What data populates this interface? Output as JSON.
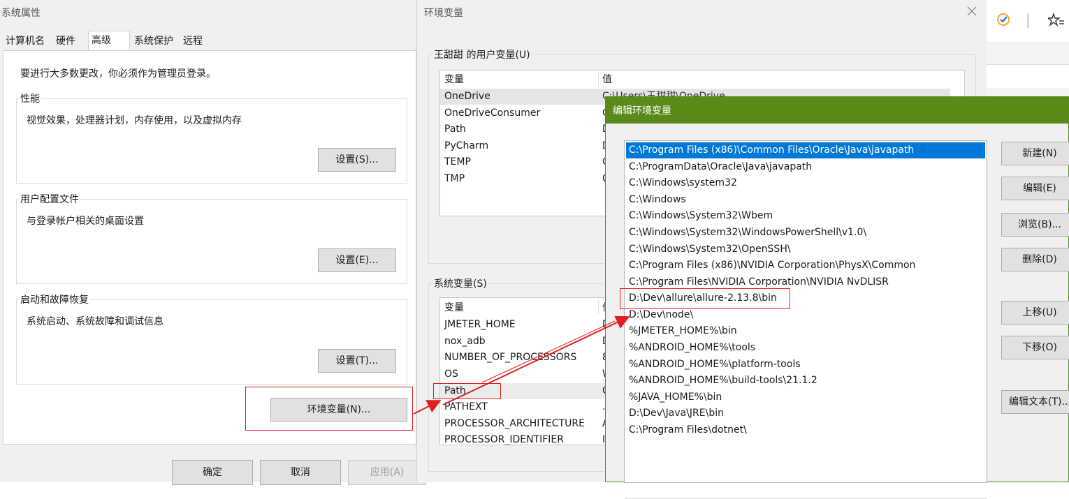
{
  "sys_props": {
    "title": "系统属性",
    "tabs": [
      "计算机名",
      "硬件",
      "高级",
      "系统保护",
      "远程"
    ],
    "admin_note": "要进行大多数更改，你必须作为管理员登录。",
    "performance": {
      "title": "性能",
      "desc": "视觉效果，处理器计划，内存使用，以及虚拟内存",
      "button": "设置(S)..."
    },
    "profiles": {
      "title": "用户配置文件",
      "desc": "与登录帐户相关的桌面设置",
      "button": "设置(E)..."
    },
    "startup": {
      "title": "启动和故障恢复",
      "desc": "系统启动、系统故障和调试信息",
      "button": "设置(T)..."
    },
    "env_button": "环境变量(N)...",
    "ok": "确定",
    "cancel": "取消",
    "apply": "应用(A)"
  },
  "env_vars": {
    "title": "环境变量",
    "user_group": "王甜甜 的用户变量(U)",
    "col_var": "变量",
    "col_val": "值",
    "user_rows": [
      {
        "name": "OneDrive",
        "value": "C:\\Users\\王甜甜\\OneDrive"
      },
      {
        "name": "OneDriveConsumer",
        "value": "C"
      },
      {
        "name": "Path",
        "value": "D"
      },
      {
        "name": "PyCharm",
        "value": "D"
      },
      {
        "name": "TEMP",
        "value": "C"
      },
      {
        "name": "TMP",
        "value": "C"
      }
    ],
    "sys_group": "系统变量(S)",
    "sys_rows": [
      {
        "name": "JMETER_HOME",
        "value": "D"
      },
      {
        "name": "nox_adb",
        "value": "D"
      },
      {
        "name": "NUMBER_OF_PROCESSORS",
        "value": "8"
      },
      {
        "name": "OS",
        "value": "W"
      },
      {
        "name": "Path",
        "value": "C"
      },
      {
        "name": "PATHEXT",
        "value": ".C"
      },
      {
        "name": "PROCESSOR_ARCHITECTURE",
        "value": "A"
      },
      {
        "name": "PROCESSOR_IDENTIFIER",
        "value": "In"
      }
    ]
  },
  "edit_env": {
    "title": "编辑环境变量",
    "paths": [
      "C:\\Program Files (x86)\\Common Files\\Oracle\\Java\\javapath",
      "C:\\ProgramData\\Oracle\\Java\\javapath",
      "C:\\Windows\\system32",
      "C:\\Windows",
      "C:\\Windows\\System32\\Wbem",
      "C:\\Windows\\System32\\WindowsPowerShell\\v1.0\\",
      "C:\\Windows\\System32\\OpenSSH\\",
      "C:\\Program Files (x86)\\NVIDIA Corporation\\PhysX\\Common",
      "C:\\Program Files\\NVIDIA Corporation\\NVIDIA NvDLISR",
      "D:\\Dev\\allure\\allure-2.13.8\\bin",
      "D:\\Dev\\node\\",
      "%JMETER_HOME%\\bin",
      "%ANDROID_HOME%\\tools",
      "%ANDROID_HOME%\\platform-tools",
      "%ANDROID_HOME%\\build-tools\\21.1.2",
      "%JAVA_HOME%\\bin",
      "D:\\Dev\\Java\\JRE\\bin",
      "C:\\Program Files\\dotnet\\"
    ],
    "buttons": {
      "new": "新建(N)",
      "edit": "编辑(E)",
      "browse": "浏览(B)...",
      "delete": "删除(D)",
      "up": "上移(U)",
      "down": "下移(O)",
      "edit_text": "编辑文本(T)..."
    }
  },
  "browser": {
    "separator": "|",
    "icons": [
      "checkmark-icon",
      "star-list-icon"
    ]
  },
  "colors": {
    "accent": "#0078d7",
    "edit_title_bar": "#5a8a1a",
    "annotation_red": "#e02020"
  }
}
